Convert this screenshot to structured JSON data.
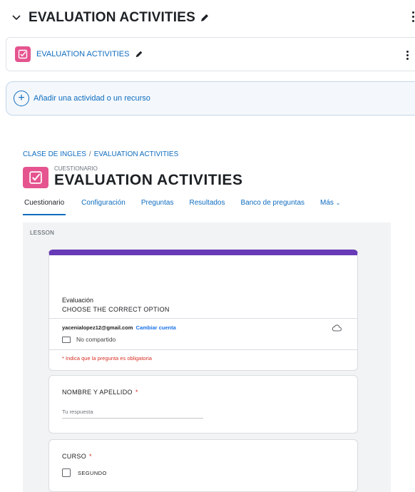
{
  "section": {
    "title": "EVALUATION ACTIVITIES",
    "icons": [
      "chevron-down-icon",
      "pencil-icon",
      "kebab-menu-icon"
    ]
  },
  "activity": {
    "name": "EVALUATION ACTIVITIES",
    "icon": "quiz-icon"
  },
  "add_activity": {
    "label": "Añadir una actividad o un recurso",
    "icon": "plus-circle-icon"
  },
  "breadcrumb": {
    "items": [
      "CLASE DE INGLES",
      "EVALUATION ACTIVITIES"
    ],
    "separator": "/"
  },
  "page": {
    "kind": "CUESTIONARIO",
    "title": "EVALUATION ACTIVITIES"
  },
  "tabs": [
    {
      "label": "Cuestionario",
      "active": true
    },
    {
      "label": "Configuración",
      "active": false
    },
    {
      "label": "Preguntas",
      "active": false
    },
    {
      "label": "Resultados",
      "active": false
    },
    {
      "label": "Banco de preguntas",
      "active": false
    },
    {
      "label": "Más",
      "active": false
    }
  ],
  "embed": {
    "label": "LESSON",
    "form": {
      "title": "Evaluación",
      "description": "CHOOSE THE CORRECT OPTION",
      "email": "yacenialopez12@gmail.com",
      "switch_account": "Cambiar cuenta",
      "not_shared": "No compartido",
      "required_note": "* Indica que la pregunta es obligatoria",
      "accent_color": "#673ab7",
      "questions": [
        {
          "label": "NOMBRE Y APELLIDO",
          "required_mark": "*",
          "placeholder": "Tu respuesta"
        },
        {
          "label": "CURSO",
          "required_mark": "*",
          "option": "SEGUNDO"
        }
      ]
    }
  },
  "colors": {
    "quiz_icon": "#e5548f",
    "link": "#0f6cbf",
    "required": "#d93025"
  }
}
